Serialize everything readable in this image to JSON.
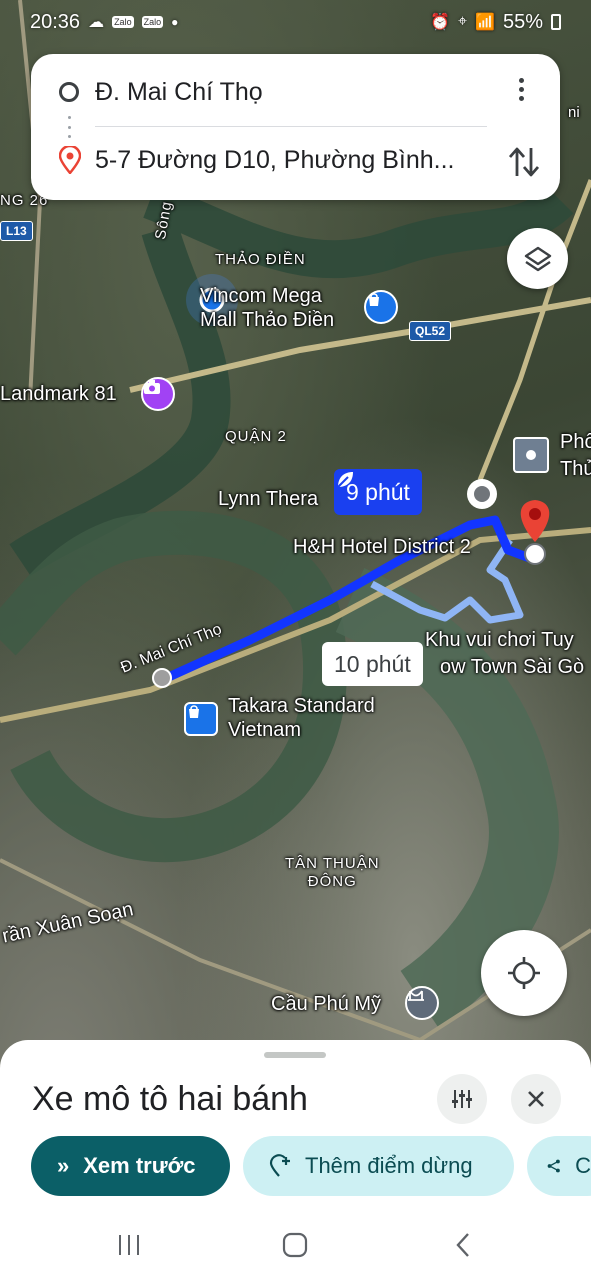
{
  "status_bar": {
    "time": "20:36",
    "notification_icons": [
      "Zalo",
      "Zalo"
    ],
    "battery": "55%"
  },
  "route": {
    "origin": "Đ. Mai Chí Thọ",
    "destination": "5-7 Đường D10, Phường Bình..."
  },
  "map": {
    "labels": {
      "thao_dien": "THẢO ĐIỀN",
      "vincom": "Vincom Mega\nMall Thảo Điền",
      "landmark": "Landmark 81",
      "quan2": "QUẬN 2",
      "lynn": "Lynn Thera",
      "hh_hotel": "H&H Hotel District 2",
      "khu_vui_choi": "Khu vui chơi Tuy",
      "snow_town": "ow Town Sài Gò",
      "takara": "Takara Standard\nVietnam",
      "tan_thuan": "TÂN THUẬN\nĐÔNG",
      "tran_xuan_soan": "rần Xuân Soạn",
      "cau_phu_my": "Cầu Phú Mỹ",
      "mai_chi_tho_road": "Đ. Mai Chí Thọ",
      "song": "Sông",
      "ng26": "NG 26",
      "pho": "Phố",
      "thu": "Thủ",
      "nhi": "ni"
    },
    "shields": {
      "ql52": "QL52",
      "l13": "L13"
    },
    "primary_eta": "9 phút",
    "alternate_eta": "10 phút"
  },
  "sheet": {
    "title": "Xe mô tô hai bánh",
    "preview": "Xem trước",
    "add_stop": "Thêm điểm dừng",
    "share": "C"
  },
  "colors": {
    "route_primary": "#1a40f0",
    "route_alt": "#8fb5f5",
    "destination_pin": "#ea4335",
    "preview_chip": "#0b5f67",
    "secondary_chip": "#cdf0f3"
  }
}
